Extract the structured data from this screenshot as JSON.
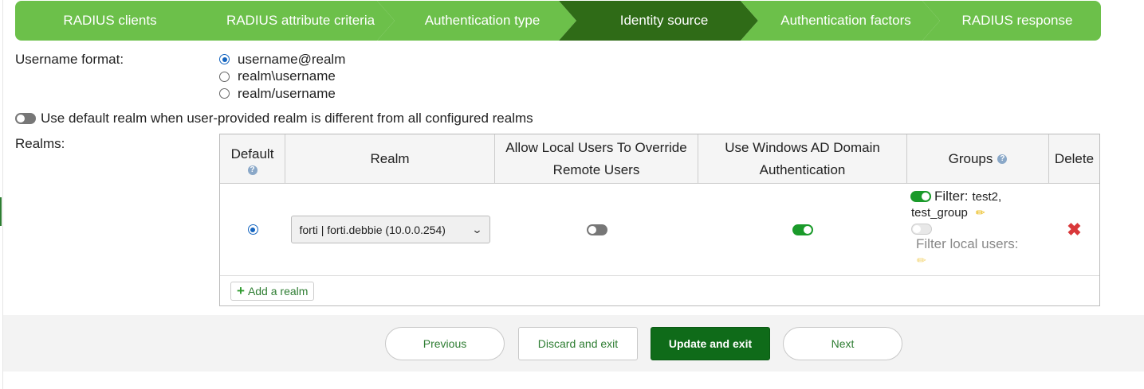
{
  "wizard": {
    "steps": [
      {
        "label": "RADIUS clients"
      },
      {
        "label": "RADIUS attribute criteria"
      },
      {
        "label": "Authentication type"
      },
      {
        "label": "Identity source"
      },
      {
        "label": "Authentication factors"
      },
      {
        "label": "RADIUS response"
      }
    ],
    "active_step": "Identity source"
  },
  "username_format": {
    "label": "Username format:",
    "options": [
      "username@realm",
      "realm\\username",
      "realm/username"
    ],
    "selected": "username@realm"
  },
  "default_realm": {
    "label": "Use default realm when user-provided realm is different from all configured realms",
    "enabled": false
  },
  "realms": {
    "label": "Realms:",
    "headers": {
      "default": "Default",
      "realm": "Realm",
      "allow_local_line1": "Allow Local Users To Override",
      "allow_local_line2": "Remote Users",
      "windows_ad_line1": "Use Windows AD Domain",
      "windows_ad_line2": "Authentication",
      "groups": "Groups",
      "delete": "Delete"
    },
    "rows": [
      {
        "default": true,
        "realm": "forti | forti.debbie (10.0.0.254)",
        "allow_local_override": false,
        "windows_ad": true,
        "filter_label": "Filter:",
        "filter_value_line1": "test2,",
        "filter_value_line2": "test_group",
        "filter_enabled": true,
        "filter_local_label": "Filter local users:",
        "filter_local_enabled": false
      }
    ],
    "add_label": "Add a realm"
  },
  "footer": {
    "previous": "Previous",
    "discard": "Discard and exit",
    "update": "Update and exit",
    "next": "Next"
  },
  "colors": {
    "step_green": "#6cc04a",
    "step_active": "#2f6b17",
    "primary_button": "#0f6b19",
    "delete_red": "#d9383a"
  }
}
